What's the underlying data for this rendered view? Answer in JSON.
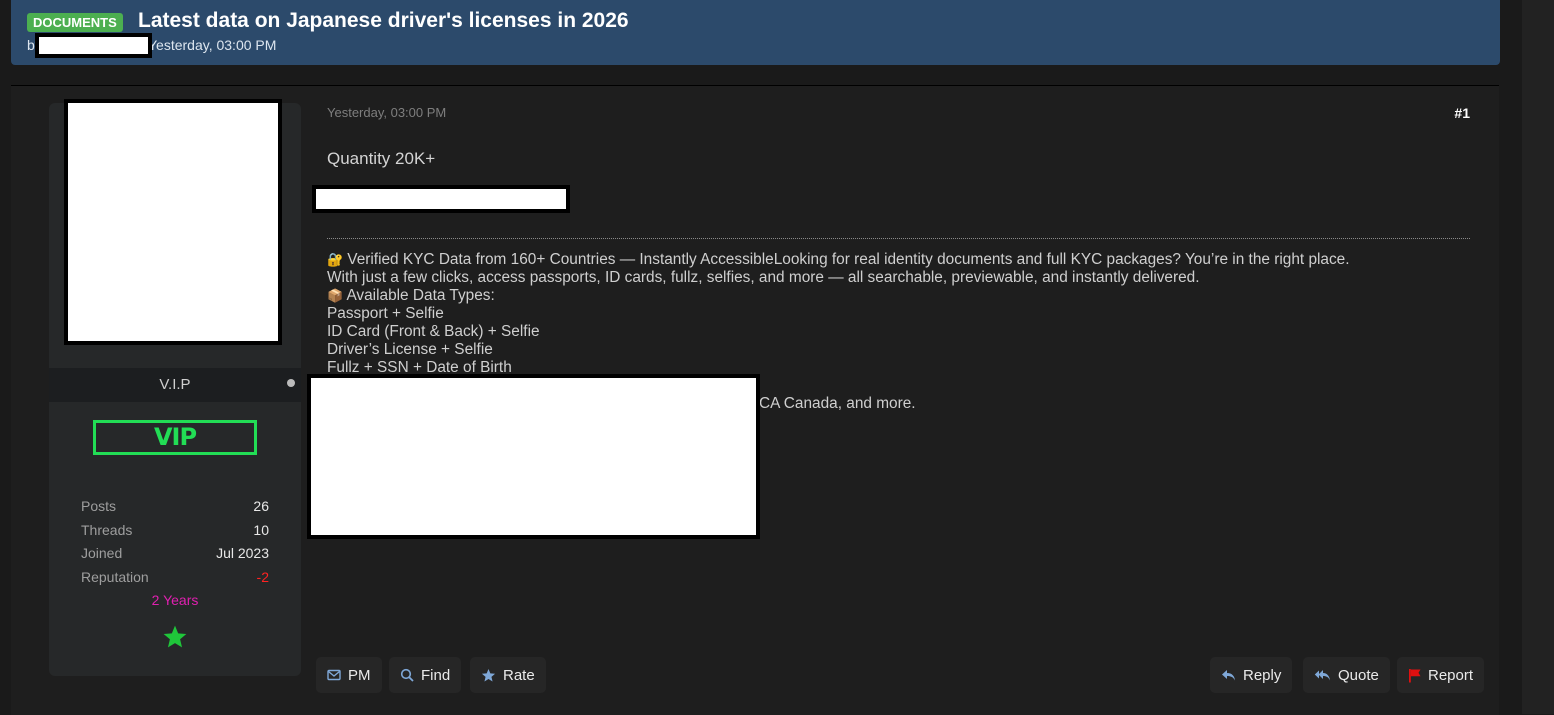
{
  "thread": {
    "prefix": "DOCUMENTS",
    "title": "Latest data on Japanese driver's licenses in 2026",
    "by_prefix": "by",
    "date": "Yesterday, 03:00 PM"
  },
  "user": {
    "rank": "V.I.P",
    "badge_text": "VIP",
    "stats": [
      {
        "label": "Posts",
        "value": "26"
      },
      {
        "label": "Threads",
        "value": "10"
      },
      {
        "label": "Joined",
        "value": "Jul 2023"
      },
      {
        "label": "Reputation",
        "value": "-2"
      }
    ],
    "tenure": "2 Years",
    "award_icon": "green-star-icon"
  },
  "post": {
    "date": "Yesterday, 03:00 PM",
    "number": "#1",
    "subject": "Quantity 20K+",
    "lines": [
      "Verified KYC Data from 160+ Countries — Instantly AccessibleLooking for real identity documents and full KYC packages? You’re in the right place.",
      "With just a few clicks, access passports, ID cards, fullz, selfies, and more — all searchable, previewable, and instantly delivered.",
      "Available Data Types:",
      "Passport + Selfie",
      "ID Card (Front & Back) + Selfie",
      "Driver’s License + Selfie",
      "Fullz + SSN + Date of Birth"
    ],
    "partial_line": "CA Canada, and more."
  },
  "actions": {
    "pm": "PM",
    "find": "Find",
    "rate": "Rate",
    "reply": "Reply",
    "quote": "Quote",
    "report": "Report"
  },
  "colors": {
    "header_bg": "#2c4a6b",
    "prefix_bg": "#4caf50",
    "vip_green": "#22dd55",
    "reputation_negative": "#ff2222",
    "tenure": "#e020b0",
    "report_flag": "#e01010"
  }
}
